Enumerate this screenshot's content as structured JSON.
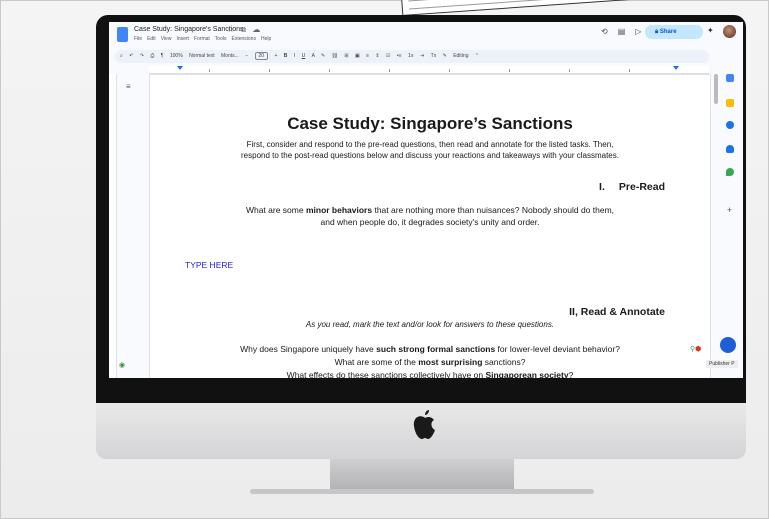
{
  "window": {
    "doc_title": "Case Study: Singapore's Sanctions",
    "menu": [
      "File",
      "Edit",
      "View",
      "Insert",
      "Format",
      "Tools",
      "Extensions",
      "Help"
    ],
    "share_label": "Share"
  },
  "toolbar": {
    "zoom": "100%",
    "style": "Normal text",
    "font": "Monts...",
    "font_size": "20",
    "mode": "Editing"
  },
  "document": {
    "title": "Case Study: Singapore’s Sanctions",
    "intro_line1": "First, consider and respond to the pre-read questions, then read and annotate for the listed tasks. Then,",
    "intro_line2": "respond to the post-read questions below and discuss your reactions and takeaways with your classmates.",
    "section1_num": "I.",
    "section1_title": "Pre-Read",
    "q1_pre": "What are some ",
    "q1_bold": "minor behaviors",
    "q1_post": " that are nothing more than nuisances? Nobody should do them,",
    "q1_line2": "and when people do, it degrades society's unity and order.",
    "type_here": "TYPE HERE",
    "section2_title": "II, Read & Annotate",
    "section2_sub": "As you read, mark the text and/or look for answers to these questions.",
    "q2_a_pre": "Why does Singapore uniquely have ",
    "q2_a_bold": "such strong formal sanctions",
    "q2_a_post": " for lower-level deviant behavior?",
    "q2_b_pre": "What are some of the ",
    "q2_b_bold": "most surprising",
    "q2_b_post": " sanctions?",
    "q2_c_pre": "What effects do these sanctions collectively have on ",
    "q2_c_bold": "Singaporean society",
    "q2_c_post": "?"
  },
  "side_panel": {
    "publisher_label": "Publisher P"
  },
  "colors": {
    "share_bg": "#c2e7ff",
    "accent_blue": "#1a73e8",
    "type_here": "#1f1fe0"
  }
}
